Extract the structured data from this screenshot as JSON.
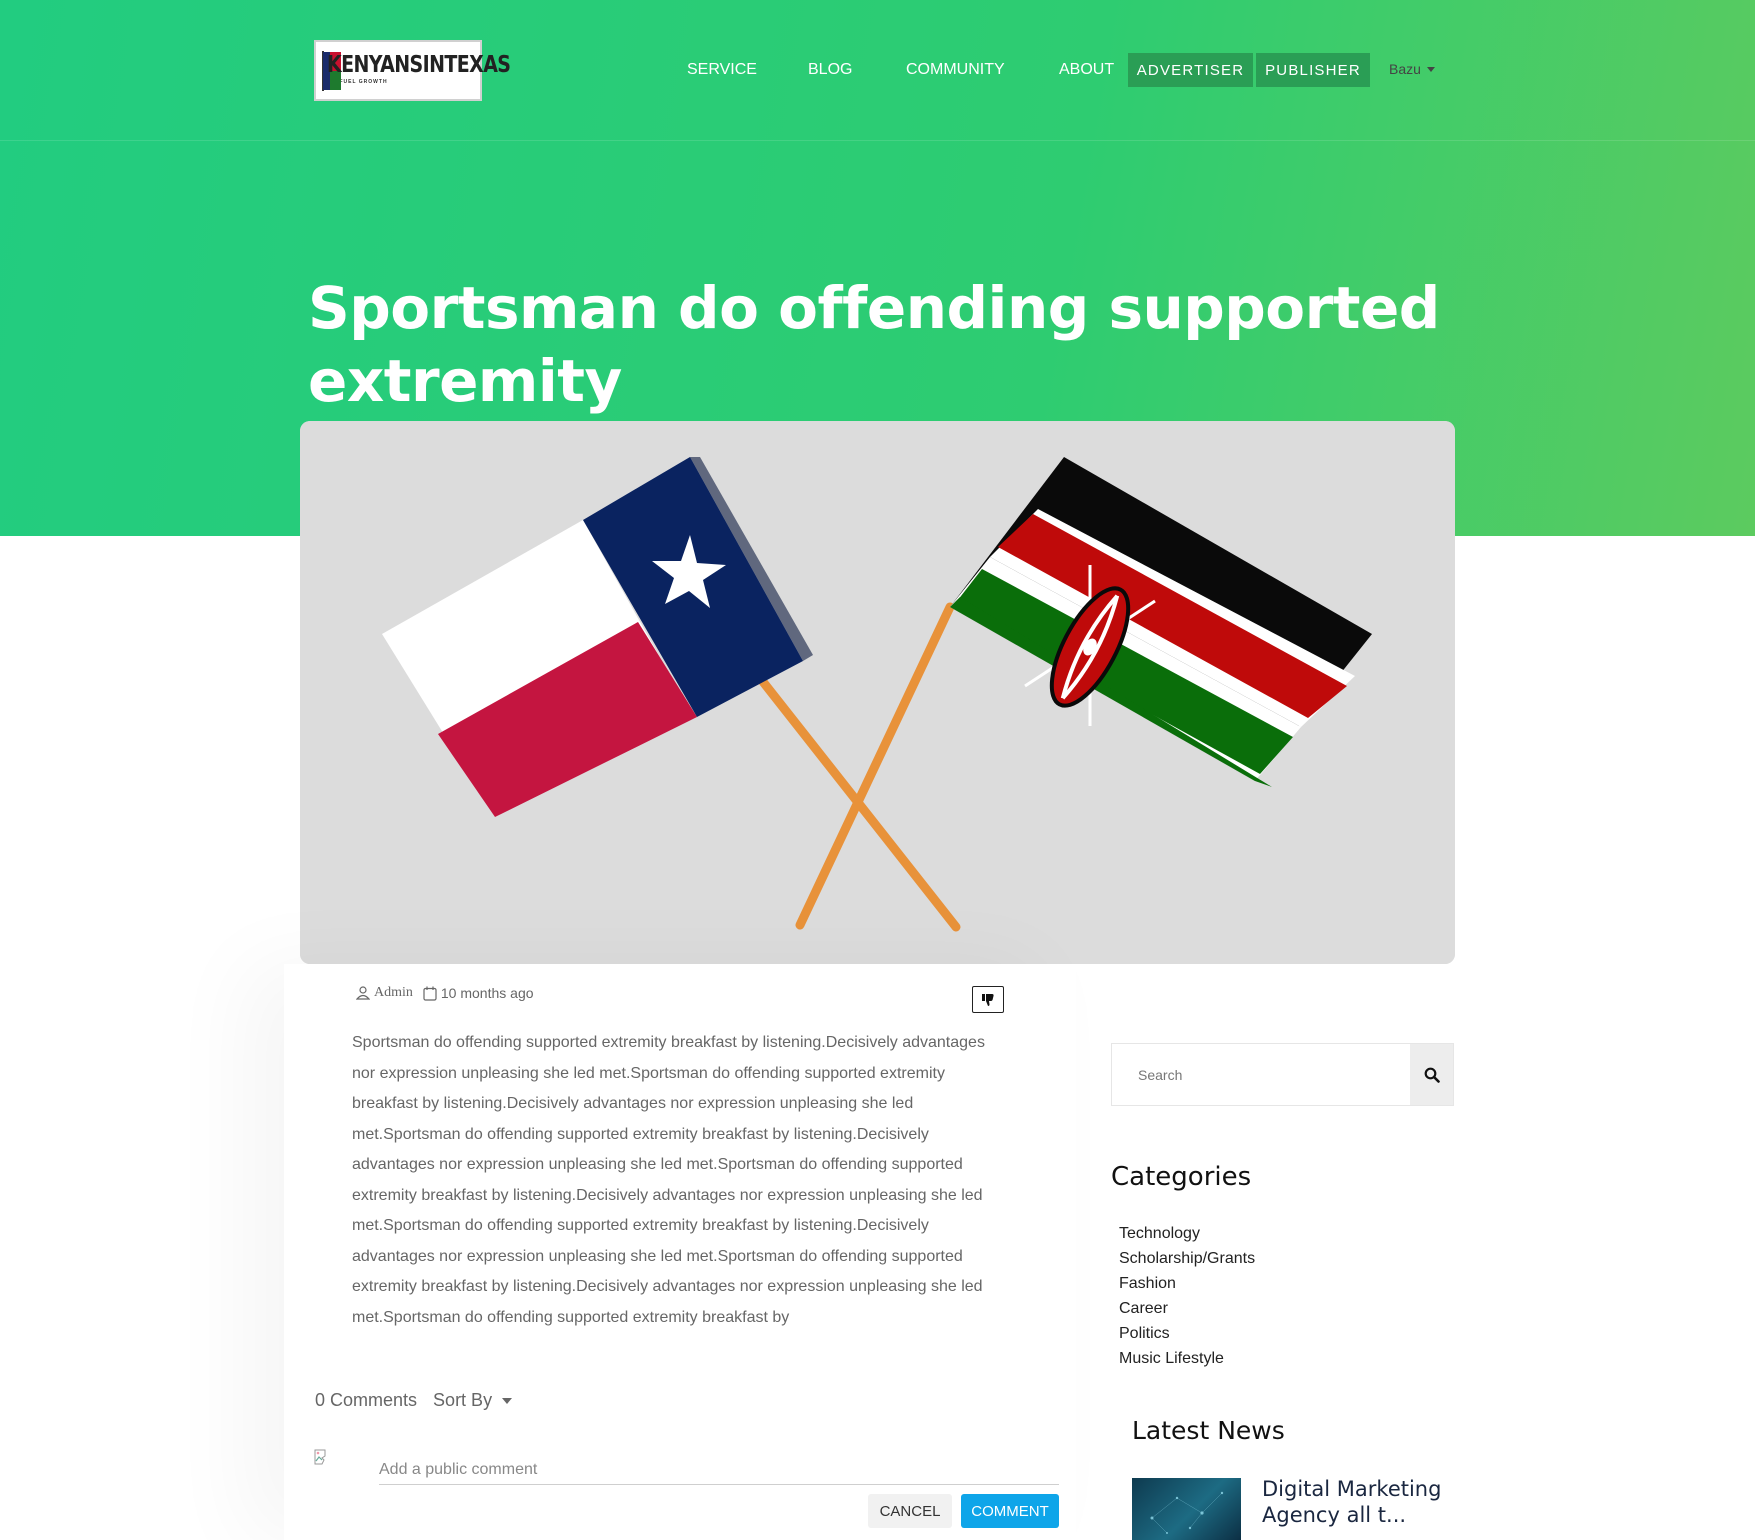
{
  "header": {
    "logo": {
      "name": "KENYANSINTEXAS",
      "tagline": "WE FUEL GROWTH"
    },
    "nav": [
      "SERVICE",
      "BLOG",
      "COMMUNITY",
      "ABOUT"
    ],
    "buttons": {
      "advertiser": "ADVERTISER",
      "publisher": "PUBLISHER"
    },
    "language": "Bazu"
  },
  "post": {
    "title": "Sportsman do offending supported extremity",
    "author": "Admin",
    "date": "10 months ago",
    "body": "Sportsman do offending supported extremity breakfast by listening.Decisively advantages nor expression unpleasing she led met.Sportsman do offending supported extremity breakfast by listening.Decisively advantages nor expression unpleasing she led met.Sportsman do offending supported extremity breakfast by listening.Decisively advantages nor expression unpleasing she led met.Sportsman do offending supported extremity breakfast by listening.Decisively advantages nor expression unpleasing she led met.Sportsman do offending supported extremity breakfast by listening.Decisively advantages nor expression unpleasing she led met.Sportsman do offending supported extremity breakfast by listening.Decisively advantages nor expression unpleasing she led met.Sportsman do offending supported extremity breakfast by"
  },
  "comments": {
    "count_label": "0 Comments",
    "sort_label": "Sort By",
    "placeholder": "Add a public comment",
    "cancel": "CANCEL",
    "submit": "COMMENT"
  },
  "sidebar": {
    "search_placeholder": "Search",
    "categories_title": "Categories",
    "categories": [
      "Technology",
      "Scholarship/Grants",
      "Fashion",
      "Career",
      "Politics",
      "Music Lifestyle"
    ],
    "latest_title": "Latest News",
    "latest": [
      {
        "title": "Digital Marketing Agency all t..."
      }
    ]
  },
  "colors": {
    "hero_green": "#2ecc71",
    "nav_button": "#2a9e55",
    "comment_button": "#0ea5e9"
  },
  "icons": [
    "user-icon",
    "calendar-icon",
    "thumbs-down-icon",
    "search-icon",
    "chevron-down-icon",
    "broken-avatar-icon"
  ]
}
